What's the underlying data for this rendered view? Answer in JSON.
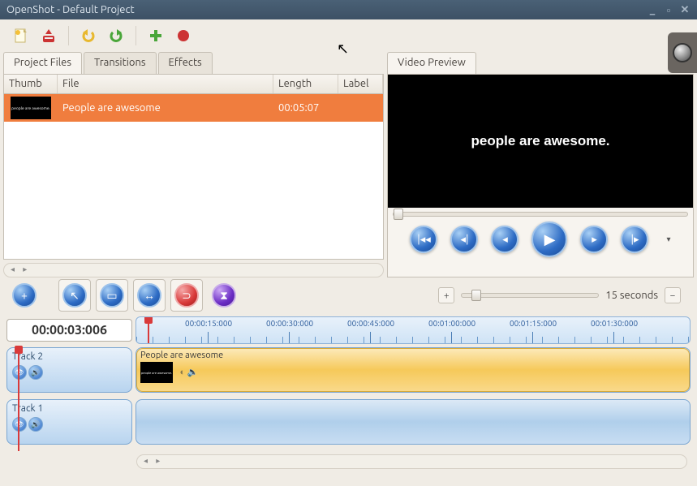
{
  "window": {
    "title": "OpenShot - Default Project"
  },
  "toolbar": {
    "new": "new-project",
    "import": "import-file",
    "undo": "undo",
    "redo": "redo",
    "add": "add",
    "record": "record"
  },
  "tabs": {
    "project_files": "Project Files",
    "transitions": "Transitions",
    "effects": "Effects"
  },
  "filelist": {
    "headers": {
      "thumb": "Thumb",
      "file": "File",
      "length": "Length",
      "label": "Label"
    },
    "rows": [
      {
        "thumb_text": "people are awesome.",
        "file": "People are awesome",
        "length": "00:05:07",
        "label": ""
      }
    ]
  },
  "preview": {
    "tab": "Video Preview",
    "video_text": "people are awesome.",
    "controls": {
      "seek_start": "seek-start",
      "prev_frame": "prev-frame",
      "rewind": "rewind",
      "play": "play",
      "fast_forward": "fast-forward",
      "seek_end": "seek-end"
    }
  },
  "tools": {
    "add_track": "add-track",
    "pointer": "pointer",
    "razor": "razor",
    "resize": "resize",
    "snap": "snap",
    "marker": "marker"
  },
  "zoom": {
    "label": "15 seconds"
  },
  "timeline": {
    "current": "00:00:03:006",
    "ticks": [
      "00:00:15:000",
      "00:00:30:000",
      "00:00:45:000",
      "00:01:00:000",
      "00:01:15:000",
      "00:01:30:000"
    ],
    "tracks": [
      {
        "name": "Track 2",
        "clip": {
          "title": "People are awesome",
          "thumb_text": "people are awesome."
        }
      },
      {
        "name": "Track 1",
        "clip": null
      }
    ]
  }
}
